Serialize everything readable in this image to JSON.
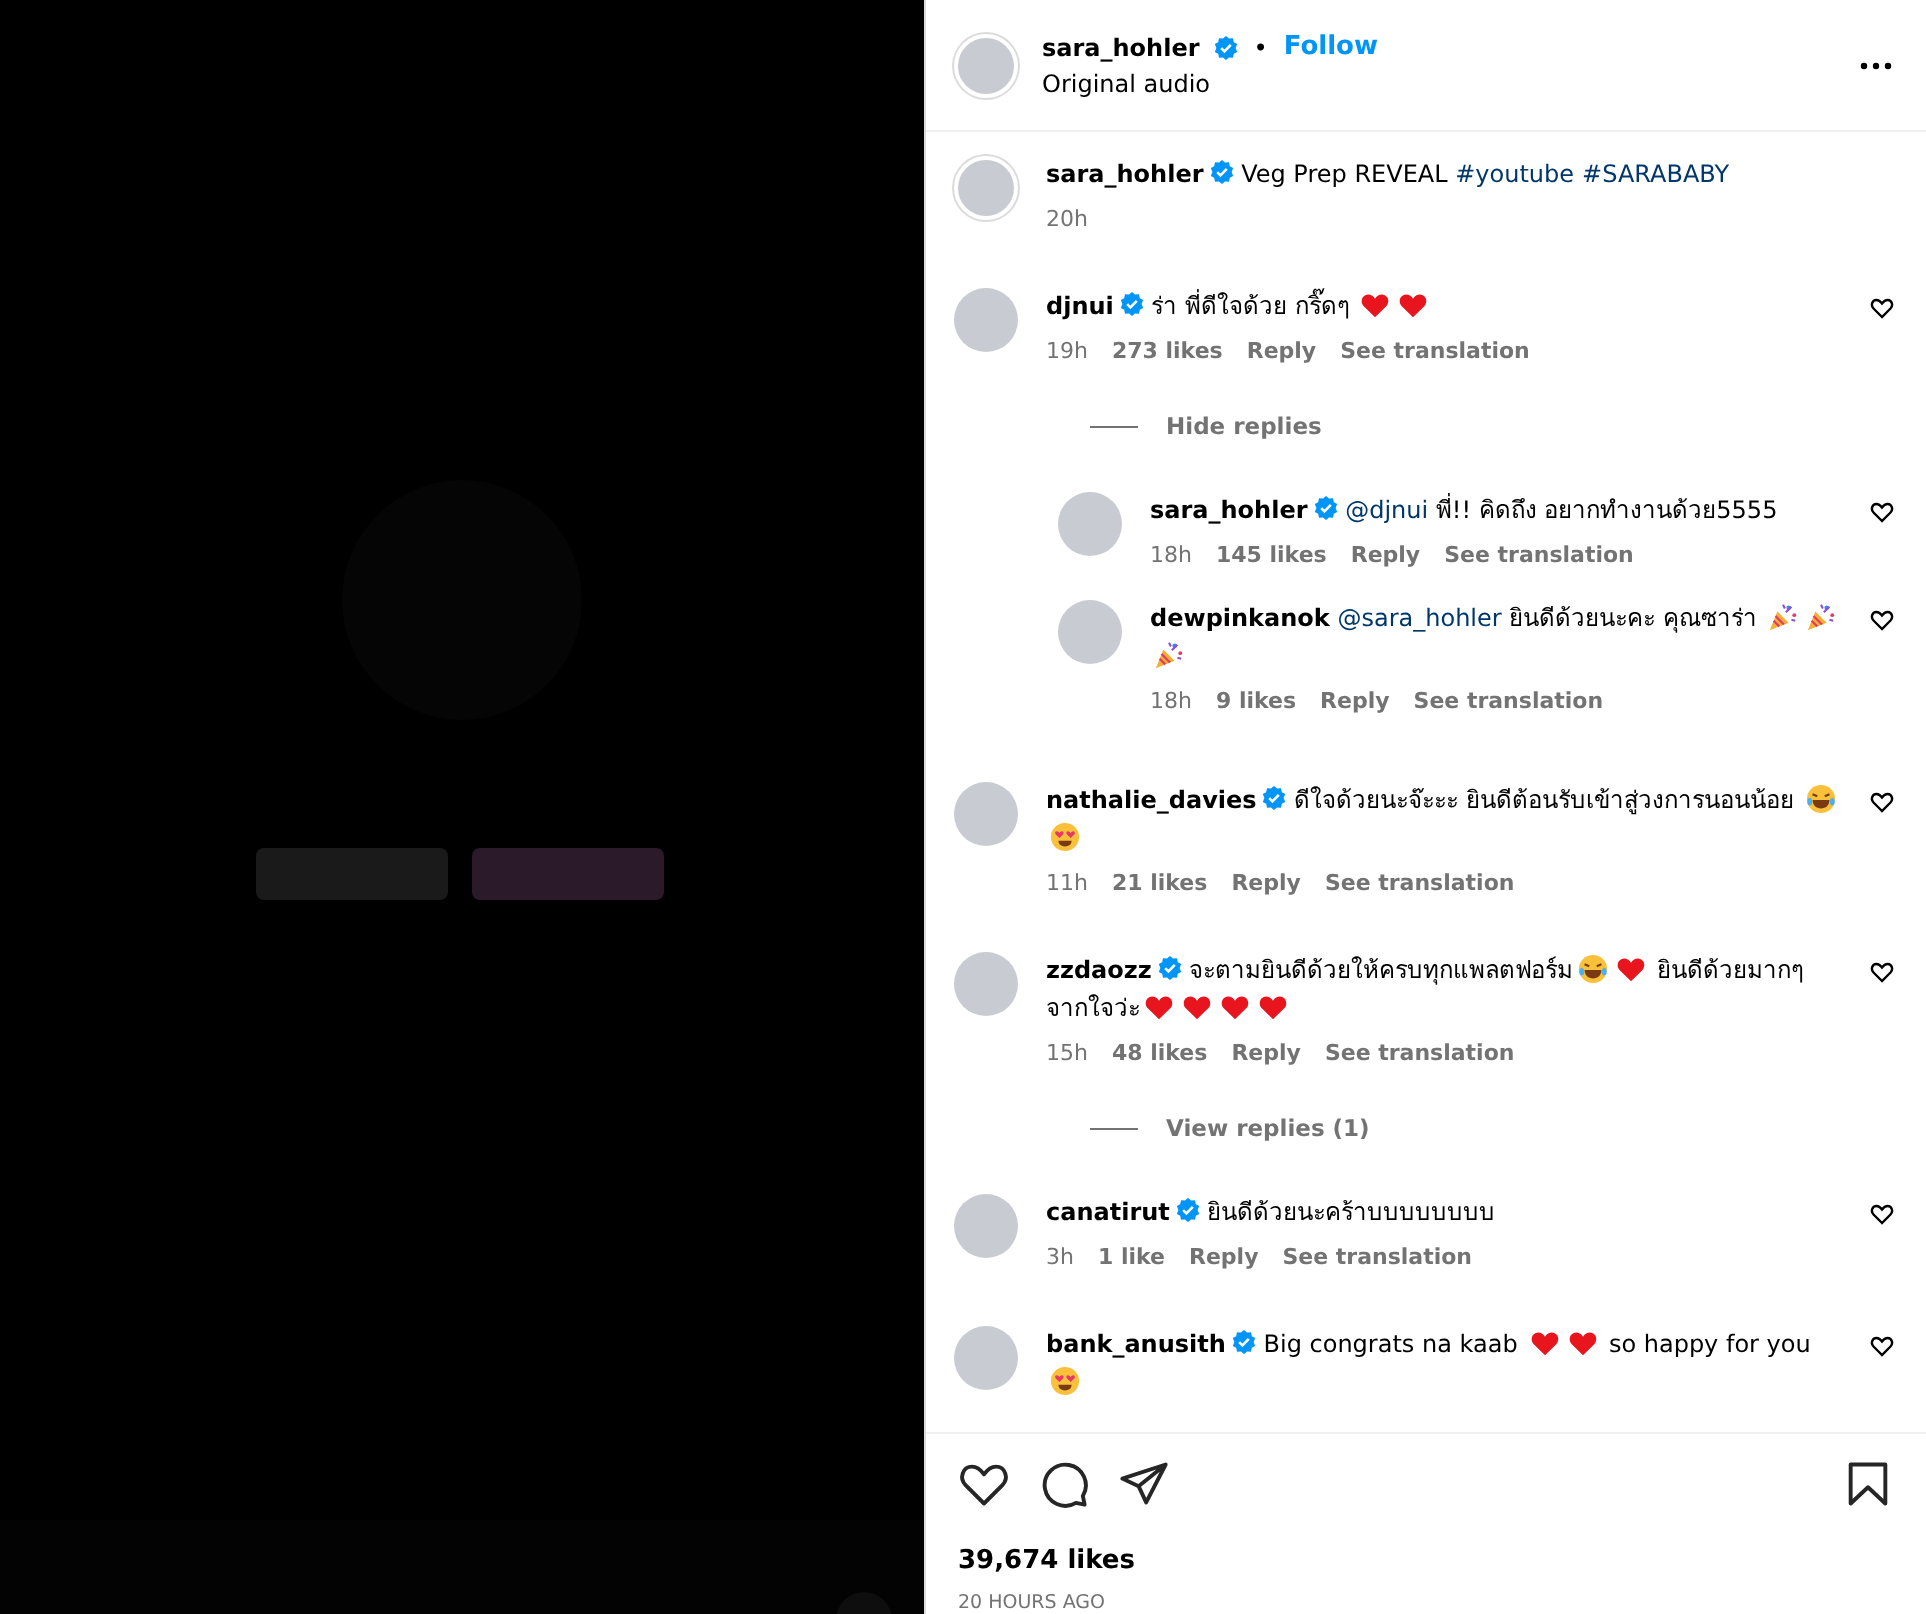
{
  "header": {
    "username": "sara_hohler",
    "verified": true,
    "separator": "•",
    "follow": "Follow",
    "audio": "Original audio"
  },
  "caption": {
    "username": "sara_hohler",
    "verified": true,
    "parts": [
      {
        "kind": "text",
        "text": "Veg Prep REVEAL "
      },
      {
        "kind": "tag",
        "text": "#youtube"
      },
      {
        "kind": "tag",
        "text": "#SARABABY"
      }
    ],
    "time": "20h"
  },
  "comments": [
    {
      "username": "djnui",
      "verified": true,
      "parts": [
        {
          "kind": "text",
          "text": "ร่า พี่ดีใจด้วย กริ๊ดๆ "
        },
        {
          "kind": "heart"
        },
        {
          "kind": "heart"
        }
      ],
      "time": "19h",
      "likes": "273 likes",
      "reply": "Reply",
      "translate": "See translation",
      "liked": false,
      "replies_toggle": "Hide replies",
      "replies": [
        {
          "username": "sara_hohler",
          "verified": true,
          "parts": [
            {
              "kind": "mention",
              "text": "@djnui"
            },
            {
              "kind": "text",
              "text": " พี่!! คิดถึง อยากทำงานด้วย5555"
            }
          ],
          "time": "18h",
          "likes": "145 likes",
          "reply": "Reply",
          "translate": "See translation",
          "liked": false
        },
        {
          "username": "dewpinkanok",
          "verified": false,
          "parts": [
            {
              "kind": "mention",
              "text": "@sara_hohler"
            },
            {
              "kind": "text",
              "text": " ยินดีด้วยนะคะ คุณซาร่า "
            },
            {
              "kind": "party"
            },
            {
              "kind": "party"
            },
            {
              "kind": "party"
            }
          ],
          "time": "18h",
          "likes": "9 likes",
          "reply": "Reply",
          "translate": "See translation",
          "liked": false
        }
      ]
    },
    {
      "username": "nathalie_davies",
      "verified": true,
      "parts": [
        {
          "kind": "text",
          "text": "ดีใจด้วยนะจ๊ะะะ ยินดีต้อนรับเข้าสู่วงการนอนน้อย "
        },
        {
          "kind": "laugh"
        },
        {
          "kind": "hearteyes"
        }
      ],
      "time": "11h",
      "likes": "21 likes",
      "reply": "Reply",
      "translate": "See translation",
      "liked": false
    },
    {
      "username": "zzdaozz",
      "verified": true,
      "parts": [
        {
          "kind": "text",
          "text": "จะตามยินดีด้วยให้ครบทุกแพลตฟอร์ม"
        },
        {
          "kind": "laugh"
        },
        {
          "kind": "heart"
        },
        {
          "kind": "text",
          "text": " ยินดีด้วยมากๆจากใจว่ะ"
        },
        {
          "kind": "heart"
        },
        {
          "kind": "heart"
        },
        {
          "kind": "heart"
        },
        {
          "kind": "heart"
        }
      ],
      "time": "15h",
      "likes": "48 likes",
      "reply": "Reply",
      "translate": "See translation",
      "liked": false,
      "replies_toggle": "View replies (1)"
    },
    {
      "username": "canatirut",
      "verified": true,
      "parts": [
        {
          "kind": "text",
          "text": "ยินดีด้วยนะคร้าบบบบบบบบ"
        }
      ],
      "time": "3h",
      "likes": "1 like",
      "reply": "Reply",
      "translate": "See translation",
      "liked": false
    },
    {
      "username": "bank_anusith",
      "verified": true,
      "parts": [
        {
          "kind": "text",
          "text": "Big congrats na kaab "
        },
        {
          "kind": "heart"
        },
        {
          "kind": "heart"
        },
        {
          "kind": "text",
          "text": " so happy for you "
        },
        {
          "kind": "hearteyes"
        }
      ],
      "liked": false
    }
  ],
  "actions": {
    "liked": false,
    "saved": false
  },
  "likes": "39,674 likes",
  "posted": "20 HOURS AGO"
}
